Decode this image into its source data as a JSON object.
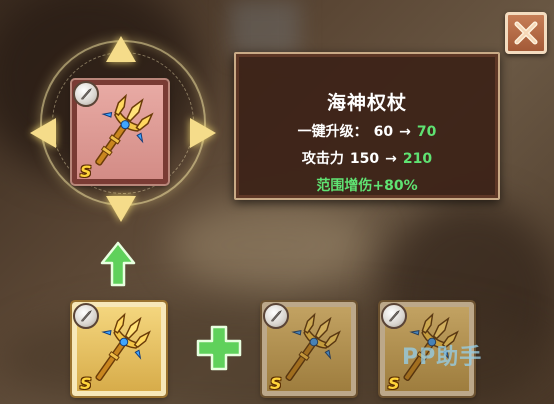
{
  "tooltip": {
    "title": "海神权杖",
    "level_label": "一键升级：",
    "level_from": "60",
    "level_to": "70",
    "attack_label": "攻击力",
    "attack_from": "150",
    "attack_to": "210",
    "bonus_text": "范围增伤+80%",
    "arrow_symbol": "→"
  },
  "items": [
    {
      "name": "海神权杖",
      "rank": "S",
      "frame": "pink",
      "badge": "sword-icon"
    },
    {
      "name": "trident",
      "rank": "S",
      "frame": "gold",
      "badge": "sword-icon"
    },
    {
      "name": "trident",
      "rank": "S",
      "frame": "gold-dim",
      "badge": "sword-icon"
    },
    {
      "name": "trident",
      "rank": "S",
      "frame": "gold-dim",
      "badge": "sword-icon"
    }
  ],
  "icons": {
    "close": "close-icon",
    "upgrade": "green-up-arrow-icon",
    "plus": "green-plus-icon",
    "weapon": "trident-icon"
  },
  "colors": {
    "stat_increase": "#5fe272",
    "tooltip_bg": "#3c2218",
    "rank_letter": "#ffd43a",
    "close_button": "#b0663f"
  },
  "watermark": "PP助手"
}
